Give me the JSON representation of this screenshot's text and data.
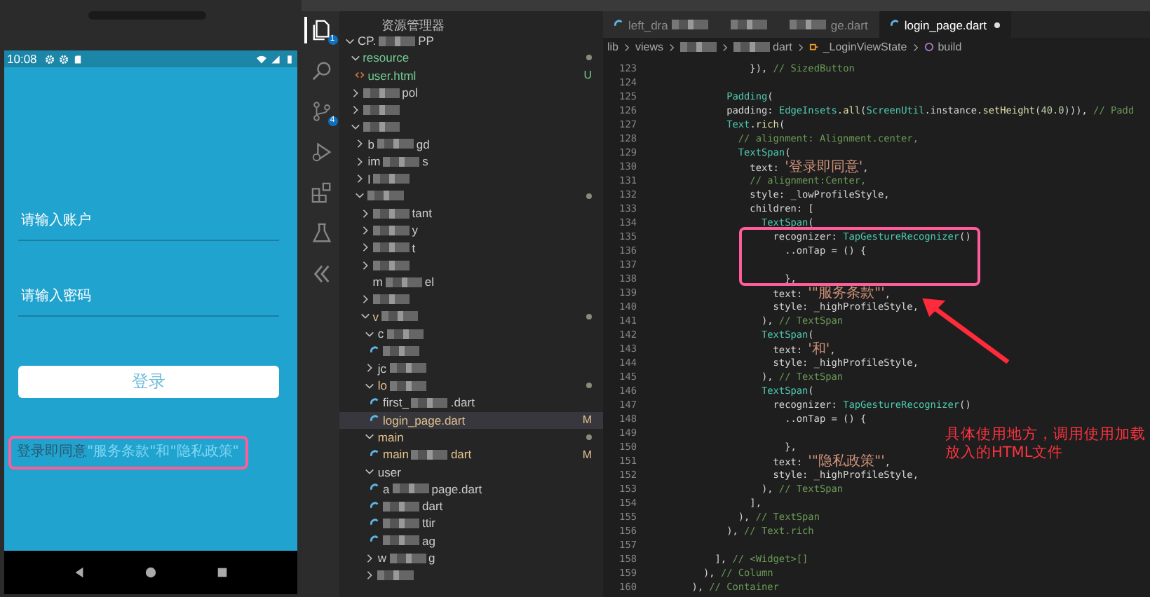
{
  "phone": {
    "status_bar": {
      "time": "10:08"
    },
    "fields": [
      {
        "placeholder": "请输入账户"
      },
      {
        "placeholder": "请输入密码"
      }
    ],
    "login_button": "登录",
    "agreement": {
      "prefix": "登录即同意",
      "links": "\"服务条款\"和\"隐私政策\""
    }
  },
  "activity_bar": [
    {
      "kind": "files",
      "selected": true,
      "badge": "1"
    },
    {
      "kind": "search",
      "selected": false
    },
    {
      "kind": "source-control",
      "selected": false,
      "badge": "4"
    },
    {
      "kind": "run",
      "selected": false
    },
    {
      "kind": "extensions",
      "selected": false
    },
    {
      "kind": "testing",
      "selected": false
    },
    {
      "kind": "flutter",
      "selected": false
    }
  ],
  "explorer": {
    "title": "资源管理器",
    "tree": [
      {
        "kind": "folder",
        "label": "CP.",
        "redacted": true,
        "tail": "PP",
        "expanded": true,
        "selected": false,
        "children": [
          {
            "kind": "folder",
            "label": "resource",
            "expanded": true,
            "selected": false,
            "color": "#73c991",
            "dot": true,
            "children": [
              {
                "kind": "html",
                "label": "user.html",
                "selected": false,
                "color": "#73c991",
                "badge": "U"
              }
            ]
          },
          {
            "kind": "folder",
            "redacted": true,
            "tail": "pol",
            "expanded": false,
            "selected": false
          },
          {
            "kind": "folder",
            "redacted": true,
            "expanded": false,
            "selected": false
          },
          {
            "kind": "folder",
            "redacted": true,
            "expanded": true,
            "selected": false,
            "children": [
              {
                "kind": "folder",
                "label": "b",
                "redacted": true,
                "tail": "gd",
                "expanded": false,
                "selected": false
              },
              {
                "kind": "folder",
                "label": "im",
                "redacted": true,
                "tail": "s",
                "expanded": false,
                "selected": false
              },
              {
                "kind": "folder",
                "label": "l",
                "redacted": true,
                "expanded": false,
                "selected": false
              },
              {
                "kind": "folder",
                "redacted": true,
                "expanded": true,
                "selected": false,
                "dot": true,
                "children": [
                  {
                    "kind": "folder",
                    "redacted": true,
                    "tail": "tant",
                    "expanded": false,
                    "selected": false
                  },
                  {
                    "kind": "folder",
                    "redacted": true,
                    "tail": "y",
                    "expanded": false,
                    "selected": false
                  },
                  {
                    "kind": "folder",
                    "redacted": true,
                    "tail": "t",
                    "expanded": false,
                    "selected": false
                  },
                  {
                    "kind": "folder",
                    "redacted": true,
                    "expanded": false,
                    "selected": false
                  },
                  {
                    "kind": "item",
                    "label": "m",
                    "redacted": true,
                    "tail": "el",
                    "selected": false
                  },
                  {
                    "kind": "folder",
                    "redacted": true,
                    "expanded": false,
                    "selected": false
                  },
                  {
                    "kind": "folder",
                    "label": "v",
                    "redacted": true,
                    "expanded": true,
                    "selected": false,
                    "color": "#e2c08d",
                    "dot": true,
                    "children": [
                      {
                        "kind": "folder",
                        "label": "c",
                        "redacted": true,
                        "expanded": true,
                        "selected": false,
                        "children": [
                          {
                            "kind": "dart",
                            "redacted": true,
                            "selected": false
                          }
                        ]
                      },
                      {
                        "kind": "folder",
                        "label": "jc",
                        "redacted": true,
                        "expanded": false,
                        "selected": false
                      },
                      {
                        "kind": "folder",
                        "label": "lo",
                        "redacted": true,
                        "expanded": true,
                        "selected": false,
                        "color": "#e2c08d",
                        "dot": true,
                        "children": [
                          {
                            "kind": "dart",
                            "label": "first_",
                            "redacted": true,
                            "tail": ".dart",
                            "selected": false
                          },
                          {
                            "kind": "dart",
                            "label": "login_page.dart",
                            "selected": true,
                            "color": "#e2c08d",
                            "badge": "M"
                          }
                        ]
                      },
                      {
                        "kind": "folder",
                        "label": "main",
                        "expanded": true,
                        "selected": false,
                        "color": "#e2c08d",
                        "dot": true,
                        "children": [
                          {
                            "kind": "dart",
                            "label": "main",
                            "redacted": true,
                            "tail": "dart",
                            "selected": false,
                            "color": "#e2c08d",
                            "badge": "M"
                          }
                        ]
                      },
                      {
                        "kind": "folder",
                        "label": "user",
                        "expanded": true,
                        "selected": false,
                        "children": [
                          {
                            "kind": "dart",
                            "label": "a",
                            "redacted": true,
                            "tail": "page.dart",
                            "selected": false
                          },
                          {
                            "kind": "dart",
                            "redacted": true,
                            "tail": "dart",
                            "selected": false
                          },
                          {
                            "kind": "dart",
                            "redacted": true,
                            "tail": "ttir",
                            "selected": false
                          },
                          {
                            "kind": "dart",
                            "redacted": true,
                            "tail": "ag",
                            "selected": false
                          }
                        ]
                      },
                      {
                        "kind": "folder",
                        "label": "w",
                        "redacted": true,
                        "tail": "g",
                        "expanded": false,
                        "selected": false
                      },
                      {
                        "kind": "folder",
                        "redacted": true,
                        "expanded": false,
                        "selected": false
                      }
                    ]
                  }
                ]
              }
            ]
          }
        ]
      }
    ]
  },
  "tabs": [
    {
      "kind": "dart",
      "label": "left_dra",
      "redacted": true,
      "selected": false,
      "modified": false
    },
    {
      "kind": "plain",
      "redacted": true,
      "selected": false,
      "modified": false
    },
    {
      "kind": "plain",
      "redacted": true,
      "tail": "ge.dart",
      "selected": false,
      "modified": false
    },
    {
      "kind": "dart",
      "label": "login_page.dart",
      "selected": true,
      "modified": true
    }
  ],
  "breadcrumb": [
    {
      "kind": "folder",
      "label": "lib"
    },
    {
      "kind": "folder",
      "label": "views"
    },
    {
      "kind": "folder",
      "redacted": true
    },
    {
      "kind": "file",
      "redacted": true,
      "tail": "dart"
    },
    {
      "kind": "class",
      "label": "_LoginViewState"
    },
    {
      "kind": "method",
      "label": "build"
    }
  ],
  "code": [
    {
      "number": "123",
      "tokens": [
        {
          "kind": "plain",
          "text": "                  }), "
        },
        {
          "kind": "comment",
          "text": "// SizedButton"
        }
      ]
    },
    {
      "number": "124"
    },
    {
      "number": "125",
      "tokens": [
        {
          "kind": "type",
          "text": "              Padding"
        },
        {
          "kind": "plain",
          "text": "("
        }
      ]
    },
    {
      "number": "126",
      "tokens": [
        {
          "kind": "plain",
          "text": "              padding: "
        },
        {
          "kind": "type",
          "text": "EdgeInsets"
        },
        {
          "kind": "plain",
          "text": "."
        },
        {
          "kind": "func",
          "text": "all"
        },
        {
          "kind": "plain",
          "text": "("
        },
        {
          "kind": "type",
          "text": "ScreenUtil"
        },
        {
          "kind": "plain",
          "text": ".instance."
        },
        {
          "kind": "func",
          "text": "setHeight"
        },
        {
          "kind": "plain",
          "text": "("
        },
        {
          "kind": "number",
          "text": "40.0"
        },
        {
          "kind": "plain",
          "text": "))), "
        },
        {
          "kind": "comment",
          "text": "// Padd"
        }
      ]
    },
    {
      "number": "127",
      "tokens": [
        {
          "kind": "type",
          "text": "              Text"
        },
        {
          "kind": "plain",
          "text": "."
        },
        {
          "kind": "func",
          "text": "rich"
        },
        {
          "kind": "plain",
          "text": "("
        }
      ]
    },
    {
      "number": "128",
      "tokens": [
        {
          "kind": "comment",
          "text": "                // alignment: Alignment.center,"
        }
      ]
    },
    {
      "number": "129",
      "tokens": [
        {
          "kind": "type",
          "text": "                TextSpan"
        },
        {
          "kind": "plain",
          "text": "("
        }
      ]
    },
    {
      "number": "130",
      "tokens": [
        {
          "kind": "plain",
          "text": "                  text: "
        },
        {
          "kind": "string",
          "text": "'登录即同意'"
        },
        {
          "kind": "plain",
          "text": ","
        }
      ]
    },
    {
      "number": "131",
      "tokens": [
        {
          "kind": "comment",
          "text": "                  // alignment:Center,"
        }
      ]
    },
    {
      "number": "132",
      "tokens": [
        {
          "kind": "plain",
          "text": "                  style: _lowProfileStyle,"
        }
      ]
    },
    {
      "number": "133",
      "tokens": [
        {
          "kind": "plain",
          "text": "                  children: ["
        }
      ]
    },
    {
      "number": "134",
      "tokens": [
        {
          "kind": "type",
          "text": "                    TextSpan"
        },
        {
          "kind": "plain",
          "text": "("
        }
      ]
    },
    {
      "number": "135",
      "tokens": [
        {
          "kind": "plain",
          "text": "                      recognizer: "
        },
        {
          "kind": "type",
          "text": "TapGestureRecognizer"
        },
        {
          "kind": "plain",
          "text": "()"
        }
      ]
    },
    {
      "number": "136",
      "tokens": [
        {
          "kind": "plain",
          "text": "                        ..onTap = () {"
        }
      ]
    },
    {
      "number": "137"
    },
    {
      "number": "138",
      "tokens": [
        {
          "kind": "plain",
          "text": "                        },"
        }
      ]
    },
    {
      "number": "139",
      "tokens": [
        {
          "kind": "plain",
          "text": "                      text: "
        },
        {
          "kind": "string",
          "text": "'\"服务条款\"'"
        },
        {
          "kind": "plain",
          "text": ","
        }
      ]
    },
    {
      "number": "140",
      "tokens": [
        {
          "kind": "plain",
          "text": "                      style: _highProfileStyle,"
        }
      ]
    },
    {
      "number": "141",
      "tokens": [
        {
          "kind": "plain",
          "text": "                    ), "
        },
        {
          "kind": "comment",
          "text": "// TextSpan"
        }
      ]
    },
    {
      "number": "142",
      "tokens": [
        {
          "kind": "type",
          "text": "                    TextSpan"
        },
        {
          "kind": "plain",
          "text": "("
        }
      ]
    },
    {
      "number": "143",
      "tokens": [
        {
          "kind": "plain",
          "text": "                      text: "
        },
        {
          "kind": "string",
          "text": "'和'"
        },
        {
          "kind": "plain",
          "text": ","
        }
      ]
    },
    {
      "number": "144",
      "tokens": [
        {
          "kind": "plain",
          "text": "                      style: _highProfileStyle,"
        }
      ]
    },
    {
      "number": "145",
      "tokens": [
        {
          "kind": "plain",
          "text": "                    ), "
        },
        {
          "kind": "comment",
          "text": "// TextSpan"
        }
      ]
    },
    {
      "number": "146",
      "tokens": [
        {
          "kind": "type",
          "text": "                    TextSpan"
        },
        {
          "kind": "plain",
          "text": "("
        }
      ]
    },
    {
      "number": "147",
      "tokens": [
        {
          "kind": "plain",
          "text": "                      recognizer: "
        },
        {
          "kind": "type",
          "text": "TapGestureRecognizer"
        },
        {
          "kind": "plain",
          "text": "()"
        }
      ]
    },
    {
      "number": "148",
      "tokens": [
        {
          "kind": "plain",
          "text": "                        ..onTap = () {"
        }
      ]
    },
    {
      "number": "149"
    },
    {
      "number": "150",
      "tokens": [
        {
          "kind": "plain",
          "text": "                        },"
        }
      ]
    },
    {
      "number": "151",
      "tokens": [
        {
          "kind": "plain",
          "text": "                      text: "
        },
        {
          "kind": "string",
          "text": "'\"隐私政策\"'"
        },
        {
          "kind": "plain",
          "text": ","
        }
      ]
    },
    {
      "number": "152",
      "tokens": [
        {
          "kind": "plain",
          "text": "                      style: _highProfileStyle,"
        }
      ]
    },
    {
      "number": "153",
      "tokens": [
        {
          "kind": "plain",
          "text": "                    ), "
        },
        {
          "kind": "comment",
          "text": "// TextSpan"
        }
      ]
    },
    {
      "number": "154",
      "tokens": [
        {
          "kind": "plain",
          "text": "                  ],"
        }
      ]
    },
    {
      "number": "155",
      "tokens": [
        {
          "kind": "plain",
          "text": "                ), "
        },
        {
          "kind": "comment",
          "text": "// TextSpan"
        }
      ]
    },
    {
      "number": "156",
      "tokens": [
        {
          "kind": "plain",
          "text": "              ), "
        },
        {
          "kind": "comment",
          "text": "// Text.rich"
        }
      ]
    },
    {
      "number": "157"
    },
    {
      "number": "158",
      "tokens": [
        {
          "kind": "plain",
          "text": "            ], "
        },
        {
          "kind": "comment",
          "text": "// <Widget>[]"
        }
      ]
    },
    {
      "number": "159",
      "tokens": [
        {
          "kind": "plain",
          "text": "          ), "
        },
        {
          "kind": "comment",
          "text": "// Column"
        }
      ]
    },
    {
      "number": "160",
      "tokens": [
        {
          "kind": "plain",
          "text": "        ), "
        },
        {
          "kind": "comment",
          "text": "// Container"
        }
      ]
    }
  ],
  "annotation": {
    "note": "具体使用地方，调用使用加载放入的HTML文件"
  }
}
